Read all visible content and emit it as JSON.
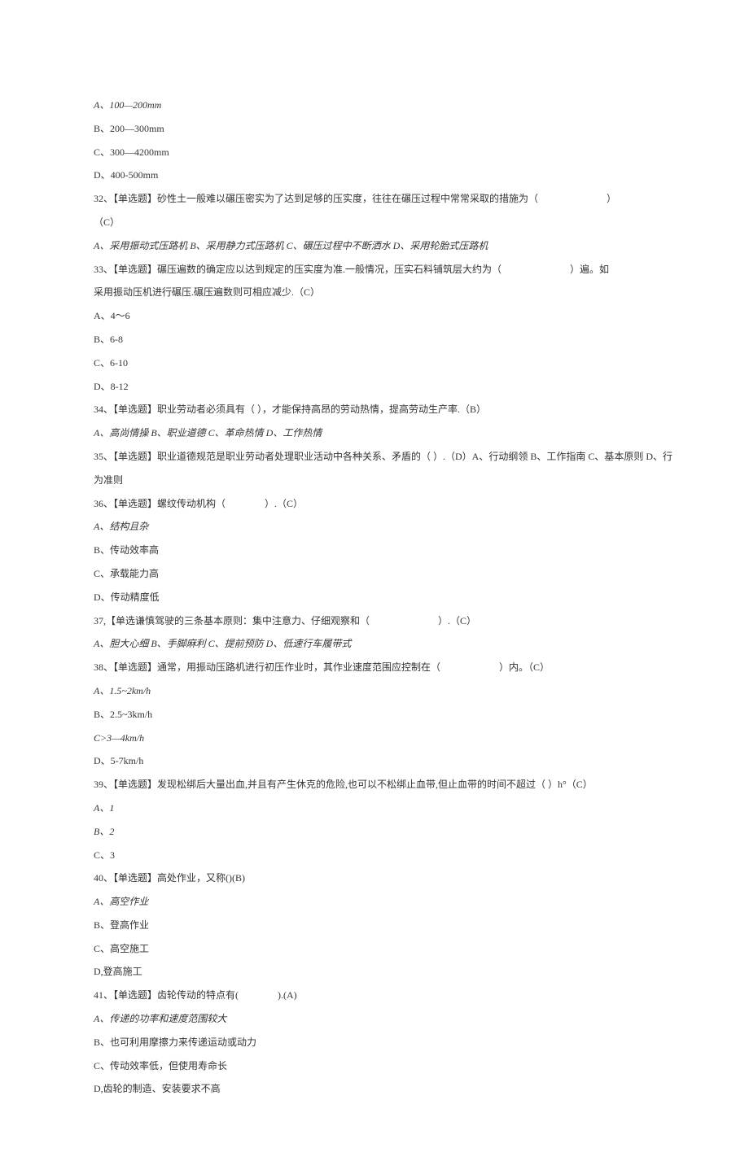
{
  "lines": [
    {
      "text": "A、100—200mm",
      "italic": true
    },
    {
      "text": "B、200—300mm"
    },
    {
      "text": "C、300—4200mm"
    },
    {
      "text": "D、400-500mm"
    },
    {
      "text": "32、【单选题】砂性土一般难以碾压密实为了达到足够的压实度，往往在碾压过程中常常采取的措施为（　　　　　　　）"
    },
    {
      "text": "（C）"
    },
    {
      "text": "A、采用振动式压路机 B、采用静力式压路机 C、碾压过程中不断洒水 D、采用轮胎式压路机",
      "italic": true
    },
    {
      "text": "33、【单选题】碾压遍数的确定应以达到规定的压实度为准.一般情况，压实石料铺筑层大约为（　　　　　　　）遍。如"
    },
    {
      "text": "采用振动压机进行碾压.碾压遍数则可相应减少.（C）"
    },
    {
      "text": "A、4～6"
    },
    {
      "text": "B、6-8"
    },
    {
      "text": "C、6-10"
    },
    {
      "text": "D、8-12"
    },
    {
      "text": "34、【单选题】职业劳动者必须具有（ ），才能保持高昂的劳动热情，提高劳动生产率.（B）"
    },
    {
      "text": "A、高尚情操 B、职业道德 C、革命热情 D、工作热情",
      "italic": true
    },
    {
      "text": "35、【单选题】职业道德规范是职业劳动者处理职业活动中各种关系、矛盾的（ ）.（D）A、行动纲领 B、工作指南 C、基本原则 D、行"
    },
    {
      "text": "为准则"
    },
    {
      "text": "36、【单选题】螺纹传动机构（　　　　）.（C）"
    },
    {
      "text": "A、结构且杂",
      "italic": true
    },
    {
      "text": "B、传动效率高"
    },
    {
      "text": "C、承载能力高"
    },
    {
      "text": "D、传动精度低"
    },
    {
      "text": "37,【单选谦慎驾驶的三条基本原则：集中注意力、仔细观察和（　　　　　　　）.（C）"
    },
    {
      "text": "A、胆大心细 B、手脚麻利 C、提前预防 D、低速行车履带式",
      "italic": true
    },
    {
      "text": "38、【单选题】通常，用振动压路机进行初压作业时，其作业速度范围应控制在（　　　　　　）内。（C）"
    },
    {
      "text": "A、1.5~2km/h",
      "italic": true
    },
    {
      "text": "B、2.5~3km/h"
    },
    {
      "text": "C>3—4km/h",
      "italic": true
    },
    {
      "text": "D、5-7km/h"
    },
    {
      "text": "39、【单选题】发现松绑后大量出血,并且有产生休克的危险,也可以不松绑止血带,但止血带的时间不超过（ ）h°（C）"
    },
    {
      "text": "A、1",
      "italic": true
    },
    {
      "text": "B、2",
      "italic": true
    },
    {
      "text": "C、3"
    },
    {
      "text": "40、【单选题】高处作业，又称()(B)"
    },
    {
      "text": "A、高空作业",
      "italic": true
    },
    {
      "text": "B、登高作业"
    },
    {
      "text": "C、高空施工"
    },
    {
      "text": "D,登高施工"
    },
    {
      "text": "41、【单选题】齿轮传动的特点有(　　　　).(A)"
    },
    {
      "text": "A、传递的功率和速度范围较大",
      "italic": true
    },
    {
      "text": "B、也可利用摩擦力来传递运动或动力"
    },
    {
      "text": "C、传动效率低，但使用寿命长"
    },
    {
      "text": "D,齿轮的制造、安装要求不高"
    }
  ]
}
